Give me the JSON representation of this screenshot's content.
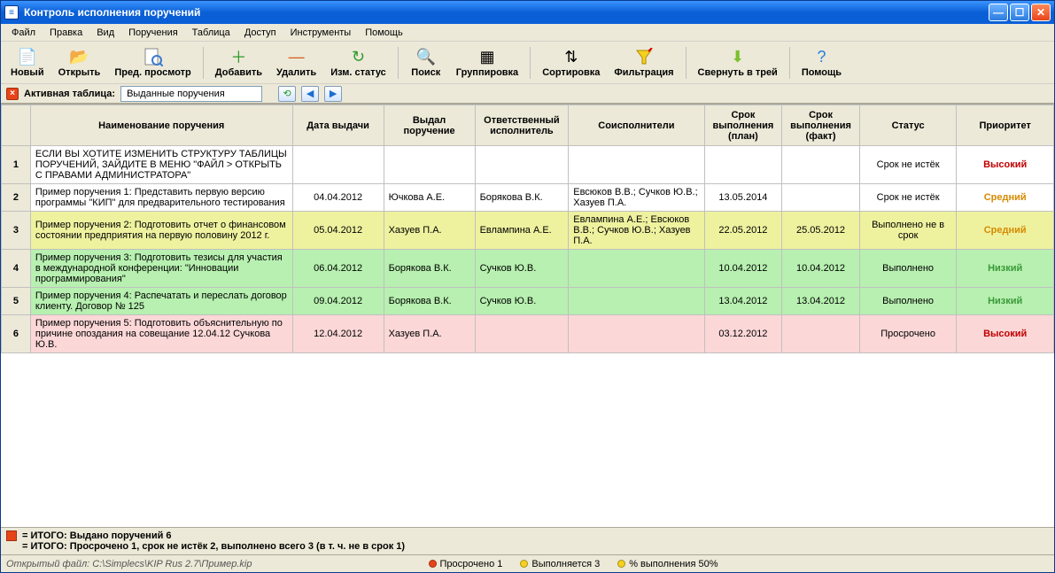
{
  "window": {
    "title": "Контроль исполнения поручений",
    "icon_letter": "≡"
  },
  "menu": [
    "Файл",
    "Правка",
    "Вид",
    "Поручения",
    "Таблица",
    "Доступ",
    "Инструменты",
    "Помощь"
  ],
  "toolbar": [
    {
      "name": "new-button",
      "icon": "📄",
      "label": "Новый"
    },
    {
      "name": "open-button",
      "icon": "📂",
      "label": "Открыть"
    },
    {
      "name": "preview-button",
      "icon": "🔍",
      "sub": "",
      "label": "Пред. просмотр",
      "iconOverride": "preview"
    },
    {
      "sep": true
    },
    {
      "name": "add-button",
      "icon": "＋",
      "color": "#2a9a2a",
      "label": "Добавить"
    },
    {
      "name": "delete-button",
      "icon": "—",
      "color": "#d85a1a",
      "label": "Удалить"
    },
    {
      "name": "change-status-button",
      "icon": "↻",
      "color": "#2a9a2a",
      "label": "Изм. статус"
    },
    {
      "sep": true
    },
    {
      "name": "search-button",
      "icon": "🔍",
      "label": "Поиск"
    },
    {
      "name": "group-button",
      "icon": "▦",
      "label": "Группировка"
    },
    {
      "sep": true
    },
    {
      "name": "sort-button",
      "icon": "⇅",
      "label": "Сортировка"
    },
    {
      "name": "filter-button",
      "icon": "▼",
      "label": "Фильтрация",
      "funnel": true
    },
    {
      "sep": true
    },
    {
      "name": "tray-button",
      "icon": "⬇",
      "color": "#7bbf2e",
      "label": "Свернуть в трей"
    },
    {
      "sep": true
    },
    {
      "name": "help-button",
      "icon": "?",
      "color": "#2a7de0",
      "label": "Помощь"
    }
  ],
  "activebar": {
    "label": "Активная таблица:",
    "value": "Выданные поручения"
  },
  "columns": [
    "",
    "Наименование поручения",
    "Дата выдачи",
    "Выдал поручение",
    "Ответственный исполнитель",
    "Соисполнители",
    "Срок выполнения (план)",
    "Срок выполнения (факт)",
    "Статус",
    "Приоритет"
  ],
  "rows": [
    {
      "n": "1",
      "cls": "row-plain",
      "name": "ЕСЛИ ВЫ ХОТИТЕ ИЗМЕНИТЬ СТРУКТУРУ ТАБЛИЦЫ ПОРУЧЕНИЙ, ЗАЙДИТЕ В МЕНЮ \"ФАЙЛ > ОТКРЫТЬ С ПРАВАМИ АДМИНИСТРАТОРА\"",
      "date": "",
      "issuer": "",
      "resp": "",
      "co": "",
      "plan": "",
      "fact": "",
      "status": "Срок не истёк",
      "prio": "Высокий",
      "prioCls": "prio-high"
    },
    {
      "n": "2",
      "cls": "row-plain",
      "name": "Пример поручения 1: Представить первую версию программы \"КИП\" для предварительного тестирования",
      "date": "04.04.2012",
      "issuer": "Ючкова А.Е.",
      "resp": "Борякова В.К.",
      "co": "Евсюков В.В.; Сучков Ю.В.; Хазуев П.А.",
      "plan": "13.05.2014",
      "fact": "",
      "status": "Срок не истёк",
      "prio": "Средний",
      "prioCls": "prio-med"
    },
    {
      "n": "3",
      "cls": "row-yellow",
      "name": "Пример поручения 2: Подготовить отчет о финансовом состоянии предприятия на первую половину 2012 г.",
      "date": "05.04.2012",
      "issuer": "Хазуев П.А.",
      "resp": "Евлампина А.Е.",
      "co": "Евлампина А.Е.; Евсюков В.В.; Сучков Ю.В.; Хазуев П.А.",
      "plan": "22.05.2012",
      "fact": "25.05.2012",
      "status": "Выполнено не в срок",
      "prio": "Средний",
      "prioCls": "prio-med"
    },
    {
      "n": "4",
      "cls": "row-green",
      "name": "Пример поручения 3: Подготовить тезисы для участия в международной конференции: \"Инновации программирования\"",
      "date": "06.04.2012",
      "issuer": "Борякова В.К.",
      "resp": "Сучков Ю.В.",
      "co": "",
      "plan": "10.04.2012",
      "fact": "10.04.2012",
      "status": "Выполнено",
      "prio": "Низкий",
      "prioCls": "prio-low"
    },
    {
      "n": "5",
      "cls": "row-green",
      "name": "Пример поручения 4: Распечатать и переслать договор клиенту. Договор № 125",
      "date": "09.04.2012",
      "issuer": "Борякова В.К.",
      "resp": "Сучков Ю.В.",
      "co": "",
      "plan": "13.04.2012",
      "fact": "13.04.2012",
      "status": "Выполнено",
      "prio": "Низкий",
      "prioCls": "prio-low"
    },
    {
      "n": "6",
      "cls": "row-pink",
      "name": "Пример поручения 5: Подготовить объяснительную по причине опоздания на совещание 12.04.12 Сучкова Ю.В.",
      "date": "12.04.2012",
      "issuer": "Хазуев П.А.",
      "resp": "",
      "co": "",
      "plan": "03.12.2012",
      "fact": "",
      "status": "Просрочено",
      "prio": "Высокий",
      "prioCls": "prio-high"
    }
  ],
  "summary": {
    "line1": "= ИТОГО: Выдано поручений 6",
    "line2": "= ИТОГО: Просрочено 1, срок не истёк 2, выполнено всего 3 (в т. ч. не в срок 1)"
  },
  "statusbar": {
    "file": "Открытый файл: C:\\Simplecs\\KIP Rus 2.7\\Пример.kip",
    "overdue": "Просрочено 1",
    "running": "Выполняется 3",
    "percent": "% выполнения 50%"
  }
}
